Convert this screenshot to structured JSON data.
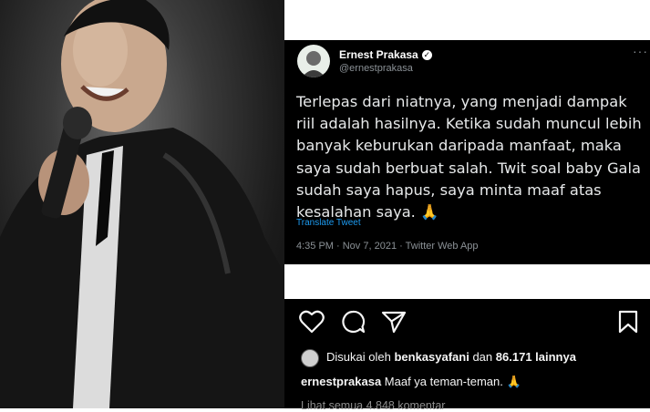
{
  "tweet": {
    "name": "Ernest Prakasa",
    "handle": "@ernestprakasa",
    "text": "Terlepas dari niatnya, yang menjadi dampak riil adalah hasilnya. Ketika sudah muncul lebih banyak keburukan daripada manfaat, maka saya sudah berbuat salah. Twit soal baby Gala sudah saya hapus, saya minta maaf atas kesalahan saya. 🙏",
    "translate": "Translate Tweet",
    "meta": "4:35 PM · Nov 7, 2021 · Twitter Web App",
    "more": "···",
    "verified_mark": "✓"
  },
  "instagram": {
    "likes_prefix": "Disukai oleh",
    "likes_user": "benkasyafani",
    "likes_mid": "dan",
    "likes_count": "86.171 lainnya",
    "caption_user": "ernestprakasa",
    "caption_text": "Maaf ya teman-teman. 🙏",
    "comments": "Lihat semua 4.848 komentar"
  },
  "icons": [
    "heart-icon",
    "comment-icon",
    "share-icon",
    "bookmark-icon",
    "verified-icon"
  ]
}
